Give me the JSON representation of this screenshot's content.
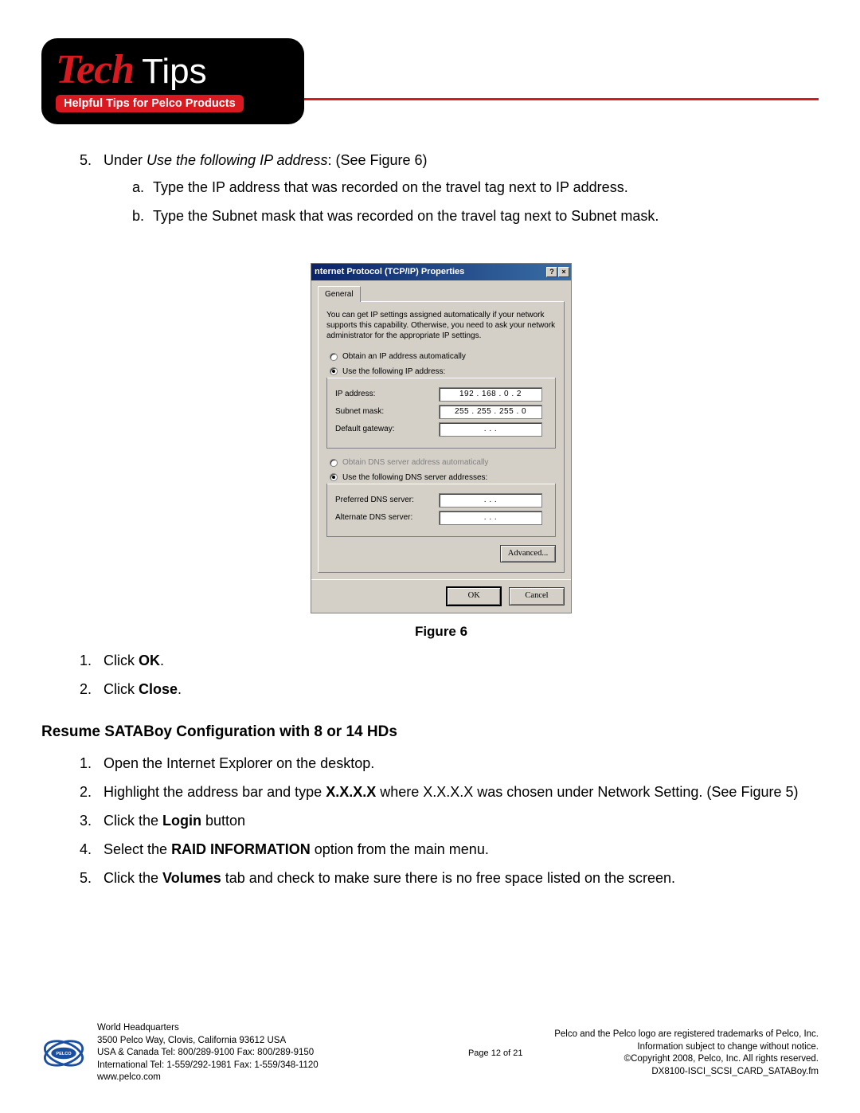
{
  "header": {
    "logo_tech": "Tech",
    "logo_tips": "Tips",
    "logo_sub": "Helpful Tips for Pelco Products"
  },
  "step5": {
    "num": "5.",
    "pre": "Under ",
    "italic": "Use the following IP address",
    "post": ": (See Figure 6)",
    "a_letter": "a.",
    "a_text": "Type the IP address that was recorded on the travel tag next to IP address.",
    "b_letter": "b.",
    "b_text": "Type the Subnet mask that was recorded on the travel tag next to Subnet mask."
  },
  "dialog": {
    "title": "nternet Protocol (TCP/IP) Properties",
    "help_btn": "?",
    "close_btn": "×",
    "tab": "General",
    "desc": "You can get IP settings assigned automatically if your network supports this capability. Otherwise, you need to ask your network administrator for the appropriate IP settings.",
    "radio_auto_ip": "Obtain an IP address automatically",
    "radio_use_ip": "Use the following IP address:",
    "ip_label": "IP address:",
    "ip_value": "192 . 168 .   0  .   2",
    "subnet_label": "Subnet mask:",
    "subnet_value": "255 . 255 . 255 .   0",
    "gateway_label": "Default gateway:",
    "gateway_value": ".          .          .",
    "radio_auto_dns": "Obtain DNS server address automatically",
    "radio_use_dns": "Use the following DNS server addresses:",
    "pref_dns_label": "Preferred DNS server:",
    "pref_dns_value": ".          .          .",
    "alt_dns_label": "Alternate DNS server:",
    "alt_dns_value": ".          .          .",
    "advanced_btn": "Advanced...",
    "ok_btn": "OK",
    "cancel_btn": "Cancel"
  },
  "figure_caption": "Figure 6",
  "steps_after": {
    "s1_num": "1.",
    "s1_pre": "Click ",
    "s1_bold": "OK",
    "s1_post": ".",
    "s2_num": "2.",
    "s2_pre": "Click ",
    "s2_bold": "Close",
    "s2_post": "."
  },
  "section_heading": "Resume SATABoy Configuration with 8 or 14 HDs",
  "resume_steps": {
    "r1_num": "1.",
    "r1_text": "Open the Internet Explorer on the desktop.",
    "r2_num": "2.",
    "r2_pre": "Highlight the address bar and type ",
    "r2_bold": "X.X.X.X",
    "r2_post": " where X.X.X.X was chosen under Network Setting. (See Figure 5)",
    "r3_num": "3.",
    "r3_pre": "Click the ",
    "r3_bold": "Login",
    "r3_post": " button",
    "r4_num": "4.",
    "r4_pre": "Select the ",
    "r4_bold": "RAID INFORMATION",
    "r4_post": " option from the main menu.",
    "r5_num": "5.",
    "r5_pre": "Click the ",
    "r5_bold": "Volumes",
    "r5_post": " tab and check to make sure there is no free space listed on the screen."
  },
  "footer": {
    "hq_title": "World Headquarters",
    "hq_addr": "3500 Pelco Way, Clovis, California 93612 USA",
    "hq_tel": "USA & Canada  Tel: 800/289-9100  Fax: 800/289-9150",
    "hq_intl": "International Tel: 1-559/292-1981 Fax: 1-559/348-1120",
    "hq_web": "www.pelco.com",
    "page": "Page 12 of 21",
    "trademark": "Pelco and the Pelco logo are registered trademarks of Pelco, Inc.",
    "notice": "Information subject to change without notice.",
    "copyright": "©Copyright 2008, Pelco, Inc. All rights reserved.",
    "docid": "DX8100-ISCI_SCSI_CARD_SATABoy.fm"
  }
}
